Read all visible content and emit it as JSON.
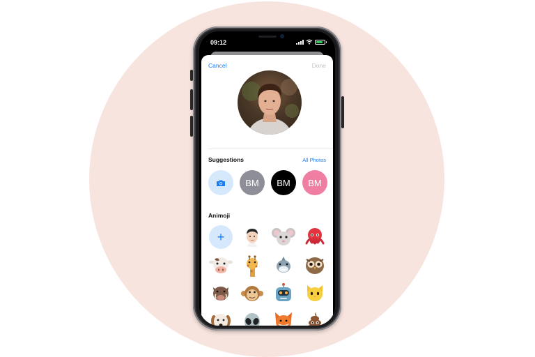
{
  "status_bar": {
    "time": "09:12"
  },
  "nav": {
    "cancel_label": "Cancel",
    "done_label": "Done"
  },
  "suggestions": {
    "title": "Suggestions",
    "link": "All Photos",
    "monograms": [
      {
        "text": "BM",
        "color": "#8e8e99"
      },
      {
        "text": "BM",
        "color": "#000000"
      },
      {
        "text": "BM",
        "color": "#f07da2"
      }
    ]
  },
  "animoji": {
    "title": "Animoji",
    "add_label": "+",
    "items": [
      [
        "add-button",
        "memoji-face-icon",
        "mouse-icon",
        "octopus-icon"
      ],
      [
        "cow-icon",
        "giraffe-icon",
        "shark-icon",
        "owl-icon"
      ],
      [
        "boar-icon",
        "monkey-icon",
        "robot-icon",
        "cat-icon"
      ],
      [
        "dog-icon",
        "alien-icon",
        "fox-icon",
        "poop-icon"
      ]
    ]
  },
  "colors": {
    "accent": "#1a7cf5",
    "accent_light": "#d6e8fb",
    "done_disabled": "#c3c3c7"
  }
}
